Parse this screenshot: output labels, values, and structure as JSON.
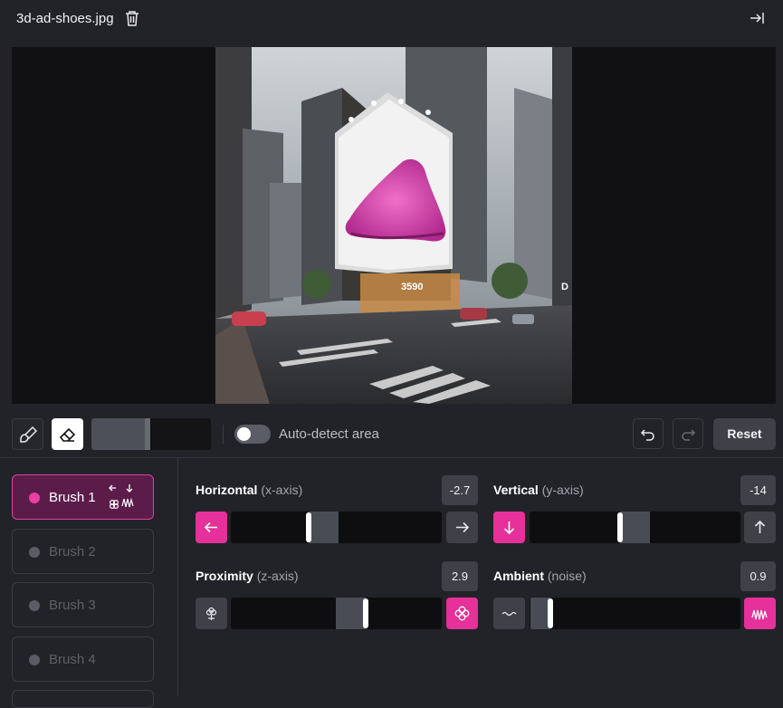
{
  "file": {
    "name": "3d-ad-shoes.jpg"
  },
  "toolbar": {
    "auto_detect_label": "Auto-detect area",
    "auto_detect_on": false,
    "reset_label": "Reset",
    "brush_size": 0.47
  },
  "brushes": [
    {
      "label": "Brush 1",
      "active": true
    },
    {
      "label": "Brush 2",
      "active": false
    },
    {
      "label": "Brush 3",
      "active": false
    },
    {
      "label": "Brush 4",
      "active": false
    }
  ],
  "controls": {
    "horizontal": {
      "label": "Horizontal",
      "axis": "(x-axis)",
      "value": "-2.7",
      "level": 0.37
    },
    "vertical": {
      "label": "Vertical",
      "axis": "(y-axis)",
      "value": "-14",
      "level": 0.43
    },
    "proximity": {
      "label": "Proximity",
      "axis": "(z-axis)",
      "value": "2.9",
      "level": 0.64
    },
    "ambient": {
      "label": "Ambient",
      "axis": "(noise)",
      "value": "0.9",
      "level": 0.1
    }
  },
  "image": {
    "billboard_sign": "3590"
  },
  "colors": {
    "accent": "#e6309a",
    "background": "#222328",
    "panel": "#3f4048"
  }
}
